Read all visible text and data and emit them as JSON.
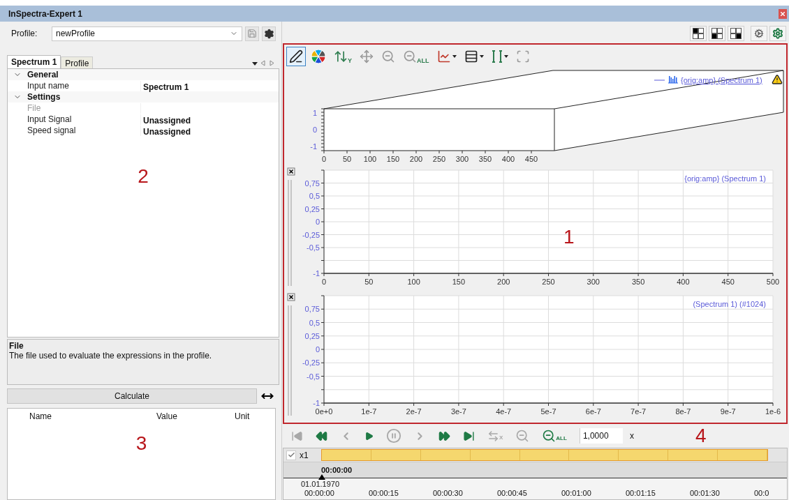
{
  "window": {
    "title": "InSpectra-Expert 1"
  },
  "profile": {
    "label": "Profile:",
    "value": "newProfile"
  },
  "tabs": [
    {
      "label": "Spectrum 1",
      "selected": true
    },
    {
      "label": "Profile",
      "selected": false
    }
  ],
  "properties": [
    {
      "name": "General",
      "expanded": true,
      "children": [
        {
          "name": "Input name",
          "value": "Spectrum 1",
          "disabled": false
        }
      ]
    },
    {
      "name": "Settings",
      "expanded": true,
      "children": [
        {
          "name": "File",
          "disabled": true
        },
        {
          "name": "Input Signal",
          "value": "Unassigned",
          "disabled": false
        },
        {
          "name": "Speed signal",
          "value": "Unassigned",
          "disabled": false
        }
      ]
    }
  ],
  "description": {
    "title": "File",
    "text": "The file used to evaluate the expressions in the profile."
  },
  "calculate": {
    "label": "Calculate"
  },
  "results": {
    "columns": [
      "Name",
      "Value",
      "Unit"
    ]
  },
  "annotations": {
    "properties": "2",
    "charts": "1",
    "results": "3",
    "player": "4"
  },
  "chart_toolbar": [
    {
      "kind": "draw",
      "selected": true
    },
    {
      "kind": "palette",
      "selected": false
    },
    {
      "kind": "axis",
      "sub": "Y",
      "selected": false
    },
    {
      "kind": "pan",
      "selected": false
    },
    {
      "kind": "zoom",
      "selected": false
    },
    {
      "kind": "zoomall",
      "sub": "ALL",
      "selected": false
    },
    {
      "kind": "lines",
      "menu": true,
      "selected": false
    },
    {
      "kind": "rows",
      "menu": true,
      "selected": false
    },
    {
      "kind": "cursor",
      "menu": true,
      "selected": false
    },
    {
      "kind": "frame",
      "selected": false
    }
  ],
  "chart3d": {
    "legend": "{orig:amp} (Spectrum 1)",
    "warning": true,
    "chart_data": {
      "type": "line",
      "xlim": [
        0,
        500
      ],
      "ylim": [
        -1,
        1
      ],
      "xticks": [
        {
          "value": 0,
          "label": "0"
        },
        {
          "value": 50,
          "label": "50"
        },
        {
          "value": 100,
          "label": "100"
        },
        {
          "value": 150,
          "label": "150"
        },
        {
          "value": 200,
          "label": "200"
        },
        {
          "value": 250,
          "label": "250"
        },
        {
          "value": 300,
          "label": "300"
        },
        {
          "value": 350,
          "label": "350"
        },
        {
          "value": 400,
          "label": "400"
        },
        {
          "value": 450,
          "label": "450"
        }
      ],
      "yticks": [
        {
          "value": 1,
          "label": "1"
        },
        {
          "value": 0,
          "label": "0"
        },
        {
          "value": -1,
          "label": "-1"
        }
      ]
    }
  },
  "charts": [
    {
      "legend": "{orig:amp} (Spectrum 1)",
      "chart_data": {
        "type": "line",
        "grid": true,
        "xlim": [
          0,
          500
        ],
        "ylim": [
          -1,
          1
        ],
        "xticks": [
          {
            "value": 0,
            "label": "0"
          },
          {
            "value": 50,
            "label": "50"
          },
          {
            "value": 100,
            "label": "100"
          },
          {
            "value": 150,
            "label": "150"
          },
          {
            "value": 200,
            "label": "200"
          },
          {
            "value": 250,
            "label": "250"
          },
          {
            "value": 300,
            "label": "300"
          },
          {
            "value": 350,
            "label": "350"
          },
          {
            "value": 400,
            "label": "400"
          },
          {
            "value": 450,
            "label": "450"
          },
          {
            "value": 500,
            "label": "500"
          }
        ],
        "yticks": [
          {
            "value": 0.75,
            "label": "0,75"
          },
          {
            "value": 0.5,
            "label": "0,5"
          },
          {
            "value": 0.25,
            "label": "0,25"
          },
          {
            "value": 0,
            "label": "0"
          },
          {
            "value": -0.25,
            "label": "-0,25"
          },
          {
            "value": -0.5,
            "label": "-0,5"
          },
          {
            "value": -1,
            "label": "-1"
          }
        ]
      }
    },
    {
      "legend": "(Spectrum 1)  (#1024)",
      "chart_data": {
        "type": "line",
        "grid": true,
        "xlim": [
          0,
          1e-06
        ],
        "ylim": [
          -1,
          1
        ],
        "xticks": [
          {
            "value": 0,
            "label": "0e+0"
          },
          {
            "value": 1e-07,
            "label": "1e-7"
          },
          {
            "value": 2e-07,
            "label": "2e-7"
          },
          {
            "value": 3e-07,
            "label": "3e-7"
          },
          {
            "value": 4e-07,
            "label": "4e-7"
          },
          {
            "value": 5e-07,
            "label": "5e-7"
          },
          {
            "value": 6e-07,
            "label": "6e-7"
          },
          {
            "value": 7e-07,
            "label": "7e-7"
          },
          {
            "value": 8e-07,
            "label": "8e-7"
          },
          {
            "value": 9e-07,
            "label": "9e-7"
          },
          {
            "value": 1e-06,
            "label": "1e-6"
          }
        ],
        "yticks": [
          {
            "value": 0.75,
            "label": "0,75"
          },
          {
            "value": 0.5,
            "label": "0,5"
          },
          {
            "value": 0.25,
            "label": "0,25"
          },
          {
            "value": 0,
            "label": "0"
          },
          {
            "value": -0.25,
            "label": "-0,25"
          },
          {
            "value": -0.5,
            "label": "-0,5"
          },
          {
            "value": -1,
            "label": "-1"
          }
        ]
      }
    }
  ],
  "player": {
    "buttons": [
      {
        "kind": "first",
        "disabled": true
      },
      {
        "kind": "rewind",
        "disabled": false
      },
      {
        "kind": "stepback",
        "disabled": true
      },
      {
        "kind": "play",
        "disabled": false
      },
      {
        "kind": "pause",
        "disabled": true
      },
      {
        "kind": "stepforward",
        "disabled": true
      },
      {
        "kind": "forward",
        "disabled": false
      },
      {
        "kind": "last",
        "disabled": false
      },
      {
        "kind": "swapx",
        "sub": "X",
        "disabled": true
      },
      {
        "kind": "zoom",
        "disabled": true
      },
      {
        "kind": "zoomall",
        "sub": "ALL",
        "disabled": false
      }
    ],
    "speed": "1,0000",
    "unit": "x"
  },
  "timeline": {
    "track": "x1",
    "checked": true,
    "position": "00:00:00",
    "date": "01.01.1970",
    "ticks": [
      "00:00:00",
      "00:00:15",
      "00:00:30",
      "00:00:45",
      "00:01:00",
      "00:01:15",
      "00:01:30",
      "00:0"
    ]
  }
}
